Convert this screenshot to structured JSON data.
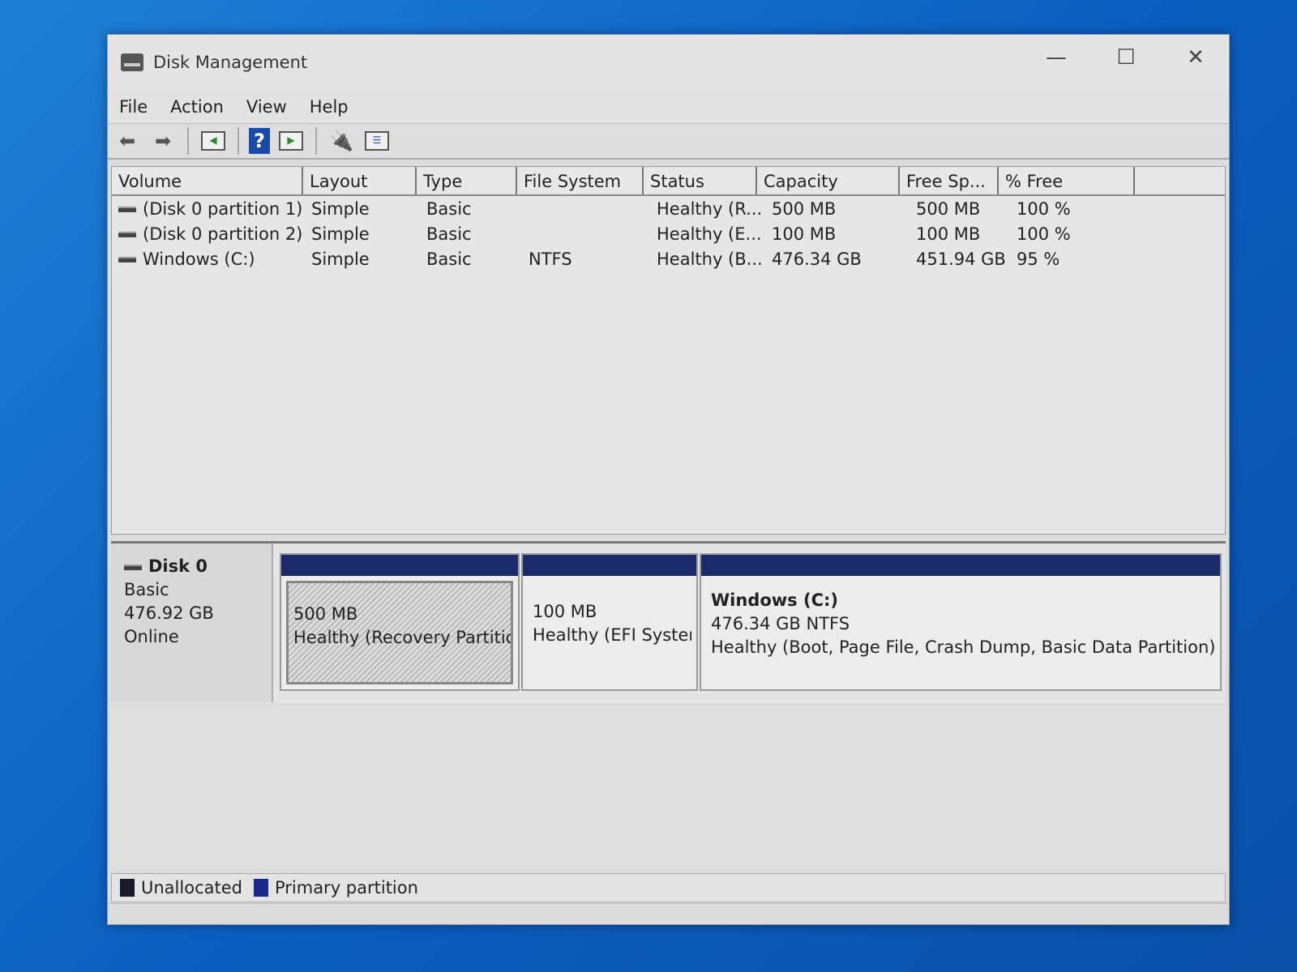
{
  "window": {
    "title": "Disk Management",
    "minimize": "—",
    "maximize": "☐",
    "close": "✕"
  },
  "menu": [
    "File",
    "Action",
    "View",
    "Help"
  ],
  "toolbar": {
    "back": "back-arrow-icon",
    "forward": "forward-arrow-icon",
    "help_glyph": "?"
  },
  "columns": [
    "Volume",
    "Layout",
    "Type",
    "File System",
    "Status",
    "Capacity",
    "Free Sp...",
    "% Free"
  ],
  "rows": [
    {
      "volume": "(Disk 0 partition 1)",
      "layout": "Simple",
      "type": "Basic",
      "fs": "",
      "status": "Healthy (R...",
      "capacity": "500 MB",
      "free": "500 MB",
      "pct": "100 %"
    },
    {
      "volume": "(Disk 0 partition 2)",
      "layout": "Simple",
      "type": "Basic",
      "fs": "",
      "status": "Healthy (E...",
      "capacity": "100 MB",
      "free": "100 MB",
      "pct": "100 %"
    },
    {
      "volume": "Windows (C:)",
      "layout": "Simple",
      "type": "Basic",
      "fs": "NTFS",
      "status": "Healthy (B...",
      "capacity": "476.34 GB",
      "free": "451.94 GB",
      "pct": "95 %"
    }
  ],
  "disk": {
    "name": "Disk 0",
    "kind": "Basic",
    "size": "476.92 GB",
    "state": "Online",
    "partitions": [
      {
        "size": "500 MB",
        "status": "Healthy (Recovery Partition)"
      },
      {
        "size": "100 MB",
        "status": "Healthy (EFI System"
      },
      {
        "name": "Windows  (C:)",
        "size": "476.34 GB NTFS",
        "status": "Healthy (Boot, Page File, Crash Dump, Basic Data Partition)"
      }
    ]
  },
  "legend": {
    "unallocated": "Unallocated",
    "primary": "Primary partition",
    "unallocated_color": "#1a1a2a",
    "primary_color": "#1a2a8a"
  }
}
